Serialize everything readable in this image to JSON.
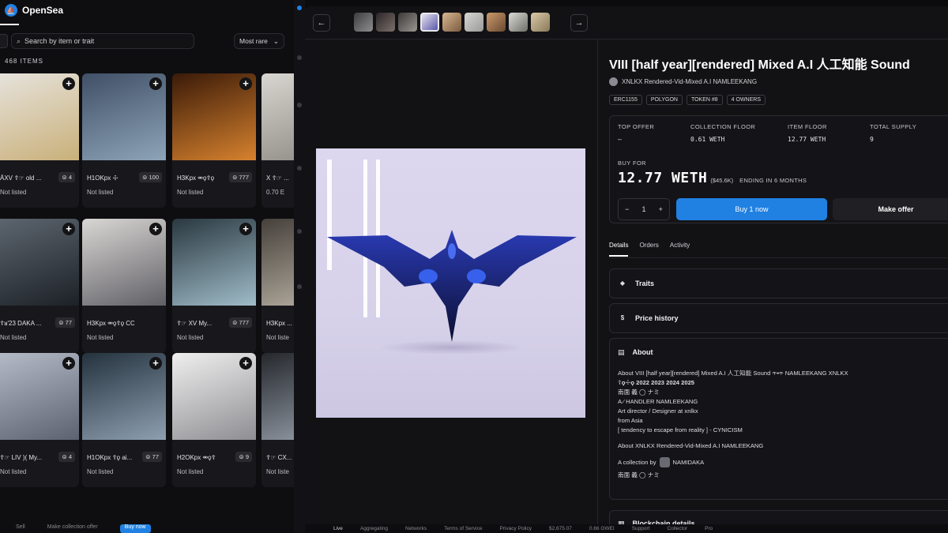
{
  "app": {
    "brand": "OpenSea"
  },
  "grid": {
    "search_placeholder": "Search by item or trait",
    "sort_label": "Most rare",
    "items_count": "468 ITEMS",
    "cards": [
      {
        "title": "ĀXV ☦☞ old ...",
        "badge": "4",
        "status": "Not listed",
        "colors": [
          "#e6e3dc",
          "#c9b07a"
        ]
      },
      {
        "title": "H1OKpx ☩",
        "badge": "100",
        "status": "Not listed",
        "colors": [
          "#405066",
          "#8ea4b8"
        ]
      },
      {
        "title": "H3Kpx ⚮ϙ☦ϙ",
        "badge": "777",
        "status": "Not listed",
        "colors": [
          "#3a1a08",
          "#d7822e"
        ]
      },
      {
        "title": "X ☦☞ ...",
        "badge": "",
        "status": "0.70 E",
        "colors": [
          "#d8d6d0",
          "#8a8880"
        ]
      },
      {
        "title": "☦ᴚ'23 DAKA ...",
        "badge": "77",
        "status": "Not listed",
        "colors": [
          "#5d6670",
          "#1c2126"
        ]
      },
      {
        "title": "H3Kpx ⚮ϙ☦ϙ CCC...",
        "badge": "",
        "status": "Not listed",
        "colors": [
          "#d9d7d4",
          "#616066"
        ]
      },
      {
        "title": "☦☞ XV My...",
        "badge": "777",
        "status": "Not listed",
        "colors": [
          "#2a3840",
          "#9fbcc8"
        ]
      },
      {
        "title": "H3Kpx ...",
        "badge": "",
        "status": "Not liste",
        "colors": [
          "#45403a",
          "#bdb5a8"
        ]
      },
      {
        "title": "☦☞ LIV )( My...",
        "badge": "4",
        "status": "Not listed",
        "colors": [
          "#b6bbc8",
          "#5c6270"
        ]
      },
      {
        "title": "H1OKpx ☦ϙ ai...",
        "badge": "77",
        "status": "Not listed",
        "colors": [
          "#24323e",
          "#8e9fb0"
        ]
      },
      {
        "title": "H2OKpx ⚮ϙ☦",
        "badge": "9",
        "status": "Not listed",
        "colors": [
          "#f0efef",
          "#8e8e92"
        ]
      },
      {
        "title": "☦☞ CX...",
        "badge": "",
        "status": "Not liste",
        "colors": [
          "#25272c",
          "#9aa3ae"
        ]
      }
    ],
    "bottom_items": [
      "Sell",
      "Make collection offer",
      "Buy now"
    ]
  },
  "item": {
    "title": "VIII [half year][rendered] Mixed A.I 人工知能 Sound",
    "creator": "XNLKX Rendered-Vid-Mixed A.I NAMLEEKANG",
    "tags": [
      "ERC1155",
      "POLYGON",
      "TOKEN #8",
      "4 OWNERS"
    ],
    "stats": [
      {
        "label": "TOP OFFER",
        "value": "–"
      },
      {
        "label": "COLLECTION FLOOR",
        "value": "0.61 WETH"
      },
      {
        "label": "ITEM FLOOR",
        "value": "12.77 WETH"
      },
      {
        "label": "TOTAL SUPPLY",
        "value": "9"
      }
    ],
    "buy_for_label": "BUY FOR",
    "price": "12.77 WETH",
    "price_usd": "($45.6K)",
    "ending": "ENDING IN 6 MONTHS",
    "quantity": "1",
    "buy_button": "Buy 1 now",
    "offer_button": "Make offer",
    "tabs": [
      "Details",
      "Orders",
      "Activity"
    ],
    "sections": {
      "traits": "Traits",
      "price_history": "Price history",
      "about": "About",
      "blockchain": "Blockchain details"
    },
    "about_lines": [
      "About VIII [half year][rendered] Mixed A.I 人工知能 Sound ጥ▪ጥ NAMLEEKANG XNLKX",
      "☦ϙ☩ϙ 2022 2023 2024 2025",
      "南面 義 ◯ ナミ",
      "A ⁄ HANDLER NAMLEEKANG",
      "Art director / Designer at xnlkx",
      "from Asia",
      "[ tendency to escape from reality ] - CYNICISM"
    ],
    "about_collection": "About XNLKX Rendered-Vid-Mixed A.I NAMLEEKANG",
    "collection_by": "A collection by",
    "collection_name": "NAMIDAKA",
    "collection_sign": "南面 義 ◯ ナミ"
  },
  "footer": [
    "Live",
    "Aggregating",
    "Networks",
    "Terms of Service",
    "Privacy Policy",
    "$2,675.07",
    "0.66 GWEI",
    "Support",
    "Collector",
    "Pro"
  ]
}
